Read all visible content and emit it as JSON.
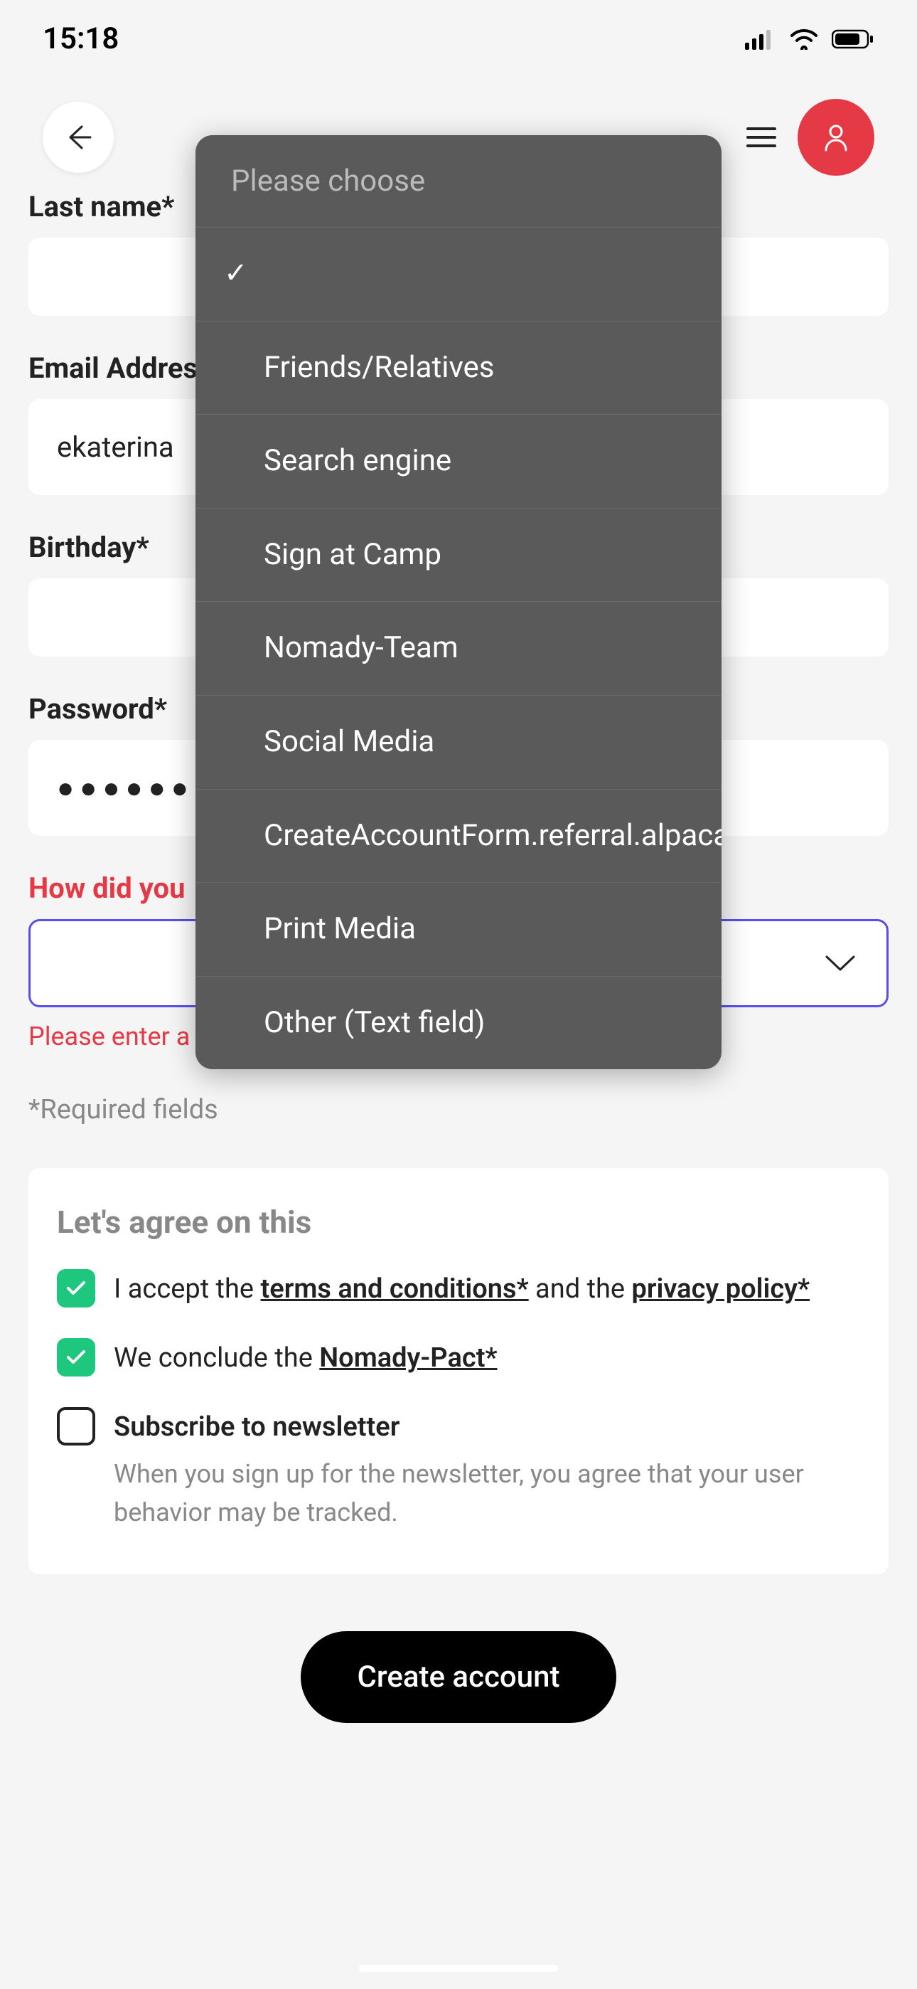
{
  "status": {
    "time": "15:18"
  },
  "form": {
    "lastNameLabel": "Last name*",
    "lastNameValue": "",
    "emailLabel": "Email Address*",
    "emailValue": "ekaterina",
    "birthdayLabel": "Birthday*",
    "birthdayValue": "",
    "passwordLabel": "Password*",
    "passwordMasked": "●●●●●●●●",
    "referralLabel": "How did you",
    "referralError": "Please enter a value for this mandatory field",
    "requiredNote": "*Required fields"
  },
  "agree": {
    "title": "Let's agree on this",
    "termsPrefix": "I accept the ",
    "termsLink": "terms and conditions*",
    "termsMid": " and the ",
    "privacyLink": "privacy policy*",
    "pactPrefix": "We conclude the ",
    "pactLink": "Nomady-Pact*",
    "newsletterLabel": "Subscribe to newsletter",
    "newsletterNote": "When you sign up for the newsletter, you agree that your user behavior may be tracked."
  },
  "submit": {
    "label": "Create account"
  },
  "dropdown": {
    "header": "Please choose",
    "items": [
      {
        "label": "",
        "selected": true
      },
      {
        "label": "Friends/Relatives",
        "selected": false
      },
      {
        "label": "Search engine",
        "selected": false
      },
      {
        "label": "Sign at Camp",
        "selected": false
      },
      {
        "label": "Nomady-Team",
        "selected": false
      },
      {
        "label": "Social Media",
        "selected": false
      },
      {
        "label": "CreateAccountForm.referral.alpacaCamping",
        "selected": false
      },
      {
        "label": "Print Media",
        "selected": false
      },
      {
        "label": "Other (Text field)",
        "selected": false
      }
    ]
  }
}
